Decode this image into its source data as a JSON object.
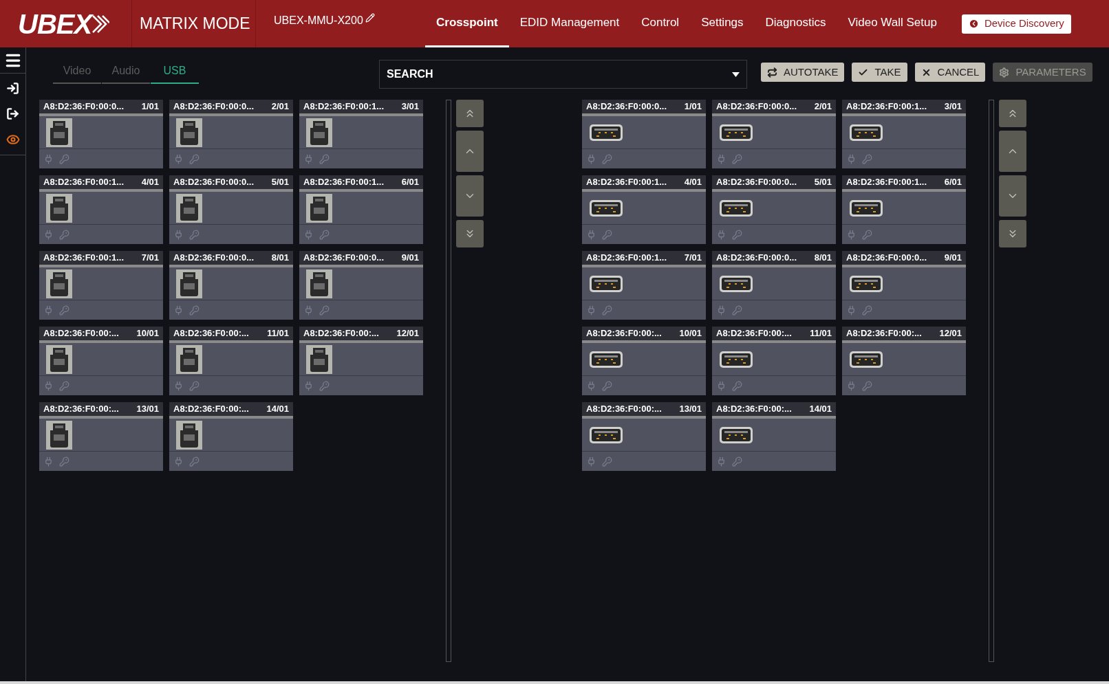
{
  "header": {
    "logo": "UBEX",
    "mode": "MATRIX MODE",
    "device_name": "UBEX-MMU-X200",
    "nav": [
      {
        "label": "Crosspoint",
        "selected": true
      },
      {
        "label": "EDID Management",
        "selected": false
      },
      {
        "label": "Control",
        "selected": false
      },
      {
        "label": "Settings",
        "selected": false
      },
      {
        "label": "Diagnostics",
        "selected": false
      },
      {
        "label": "Video Wall Setup",
        "selected": false
      }
    ],
    "discovery_button": "Device Discovery"
  },
  "tabs": [
    {
      "label": "Video",
      "selected": false
    },
    {
      "label": "Audio",
      "selected": false
    },
    {
      "label": "USB",
      "selected": true
    }
  ],
  "search": {
    "value": "SEARCH"
  },
  "actions": [
    {
      "kind": "autotake",
      "label": "AUTOTAKE",
      "disabled": false
    },
    {
      "kind": "take",
      "label": "TAKE",
      "disabled": false
    },
    {
      "kind": "cancel",
      "label": "CANCEL",
      "disabled": false
    },
    {
      "kind": "parameters",
      "label": "PARAMETERS",
      "disabled": true
    }
  ],
  "panels": [
    {
      "kind": "usb-b",
      "cards": [
        {
          "name": "A8:D2:36:F0:00:0...",
          "port": "1/01"
        },
        {
          "name": "A8:D2:36:F0:00:0...",
          "port": "2/01"
        },
        {
          "name": "A8:D2:36:F0:00:1...",
          "port": "3/01"
        },
        {
          "name": "A8:D2:36:F0:00:1...",
          "port": "4/01"
        },
        {
          "name": "A8:D2:36:F0:00:0...",
          "port": "5/01"
        },
        {
          "name": "A8:D2:36:F0:00:1...",
          "port": "6/01"
        },
        {
          "name": "A8:D2:36:F0:00:1...",
          "port": "7/01"
        },
        {
          "name": "A8:D2:36:F0:00:0...",
          "port": "8/01"
        },
        {
          "name": "A8:D2:36:F0:00:0...",
          "port": "9/01"
        },
        {
          "name": "A8:D2:36:F0:00:...",
          "port": "10/01"
        },
        {
          "name": "A8:D2:36:F0:00:...",
          "port": "11/01"
        },
        {
          "name": "A8:D2:36:F0:00:...",
          "port": "12/01"
        },
        {
          "name": "A8:D2:36:F0:00:...",
          "port": "13/01"
        },
        {
          "name": "A8:D2:36:F0:00:...",
          "port": "14/01"
        }
      ]
    },
    {
      "kind": "usb-a",
      "cards": [
        {
          "name": "A8:D2:36:F0:00:0...",
          "port": "1/01"
        },
        {
          "name": "A8:D2:36:F0:00:0...",
          "port": "2/01"
        },
        {
          "name": "A8:D2:36:F0:00:1...",
          "port": "3/01"
        },
        {
          "name": "A8:D2:36:F0:00:1...",
          "port": "4/01"
        },
        {
          "name": "A8:D2:36:F0:00:0...",
          "port": "5/01"
        },
        {
          "name": "A8:D2:36:F0:00:1...",
          "port": "6/01"
        },
        {
          "name": "A8:D2:36:F0:00:1...",
          "port": "7/01"
        },
        {
          "name": "A8:D2:36:F0:00:0...",
          "port": "8/01"
        },
        {
          "name": "A8:D2:36:F0:00:0...",
          "port": "9/01"
        },
        {
          "name": "A8:D2:36:F0:00:...",
          "port": "10/01"
        },
        {
          "name": "A8:D2:36:F0:00:...",
          "port": "11/01"
        },
        {
          "name": "A8:D2:36:F0:00:...",
          "port": "12/01"
        },
        {
          "name": "A8:D2:36:F0:00:...",
          "port": "13/01"
        },
        {
          "name": "A8:D2:36:F0:00:...",
          "port": "14/01"
        }
      ]
    }
  ]
}
